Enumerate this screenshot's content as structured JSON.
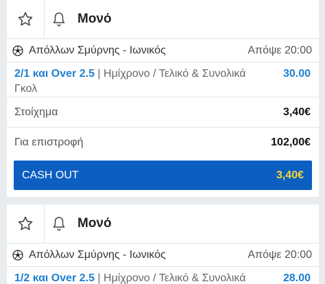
{
  "bets": [
    {
      "title": "Μονό",
      "match": "Απόλλων Σμύρνης - Ιωνικός",
      "time": "Απόψε 20:00",
      "pick": "2/1 και Over 2.5",
      "separator": " | ",
      "market": "Ημίχρονο / Τελικό & Συνολικά Γκολ",
      "odds": "30.00",
      "stake_label": "Στοίχημα",
      "stake_value": "3,40€",
      "return_label": "Για επιστροφή",
      "return_value": "102,00€",
      "cashout_label": "CASH OUT",
      "cashout_value": "3,40€"
    },
    {
      "title": "Μονό",
      "match": "Απόλλων Σμύρνης - Ιωνικός",
      "time": "Απόψε 20:00",
      "pick": "1/2 και Over 2.5",
      "separator": " | ",
      "market": "Ημίχρονο / Τελικό & Συνολικά",
      "odds": "28.00"
    }
  ],
  "icons": {
    "favorite": "star-icon",
    "notify": "bell-icon",
    "sport": "soccer-ball-icon"
  },
  "colors": {
    "accent": "#1f7fd1",
    "cashout_bg": "#0c5fc1",
    "cashout_value": "#f7d83a"
  }
}
